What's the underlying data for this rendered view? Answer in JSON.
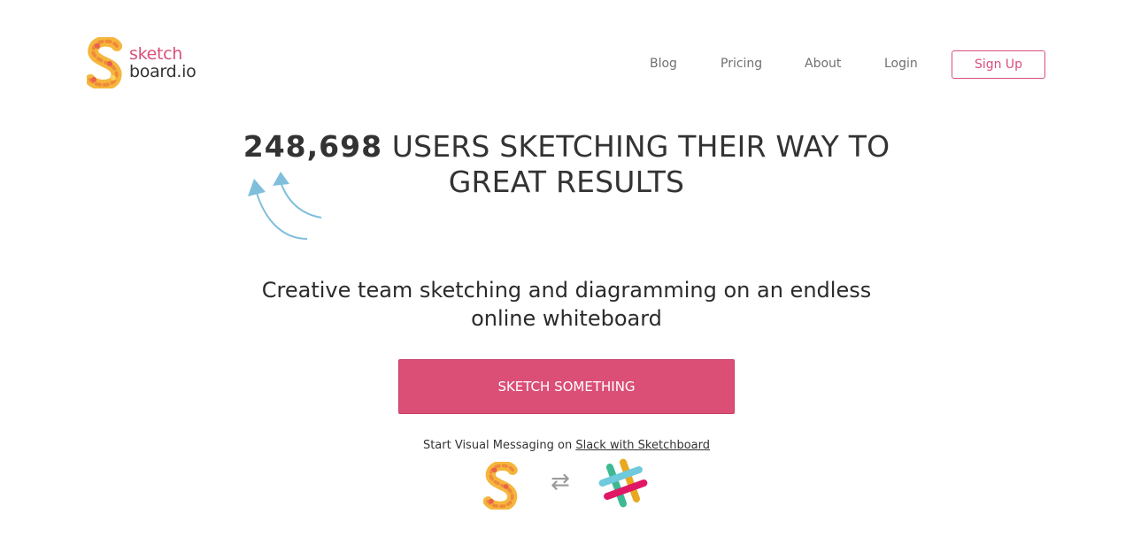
{
  "brand": {
    "line1": "sketch",
    "line2": "board.io",
    "accent_color": "#db4f77",
    "logo_icon": "s-mosaic-logo-icon"
  },
  "nav": {
    "blog": "Blog",
    "pricing": "Pricing",
    "about": "About",
    "login": "Login",
    "signup": "Sign Up"
  },
  "hero": {
    "count": "248,698",
    "headline_rest": " USERS SKETCHING THEIR WAY TO GREAT RESULTS",
    "subtitle": "Creative team sketching and diagramming on an endless online whiteboard",
    "cta": "SKETCH SOMETHING",
    "arrows_icon": "curved-arrows-icon"
  },
  "slack": {
    "prefix": "Start Visual Messaging on ",
    "link": "Slack with Sketchboard",
    "swap_icon": "swap-arrows-icon",
    "swap_glyph": "⇄",
    "slack_icon": "slack-logo-icon"
  }
}
